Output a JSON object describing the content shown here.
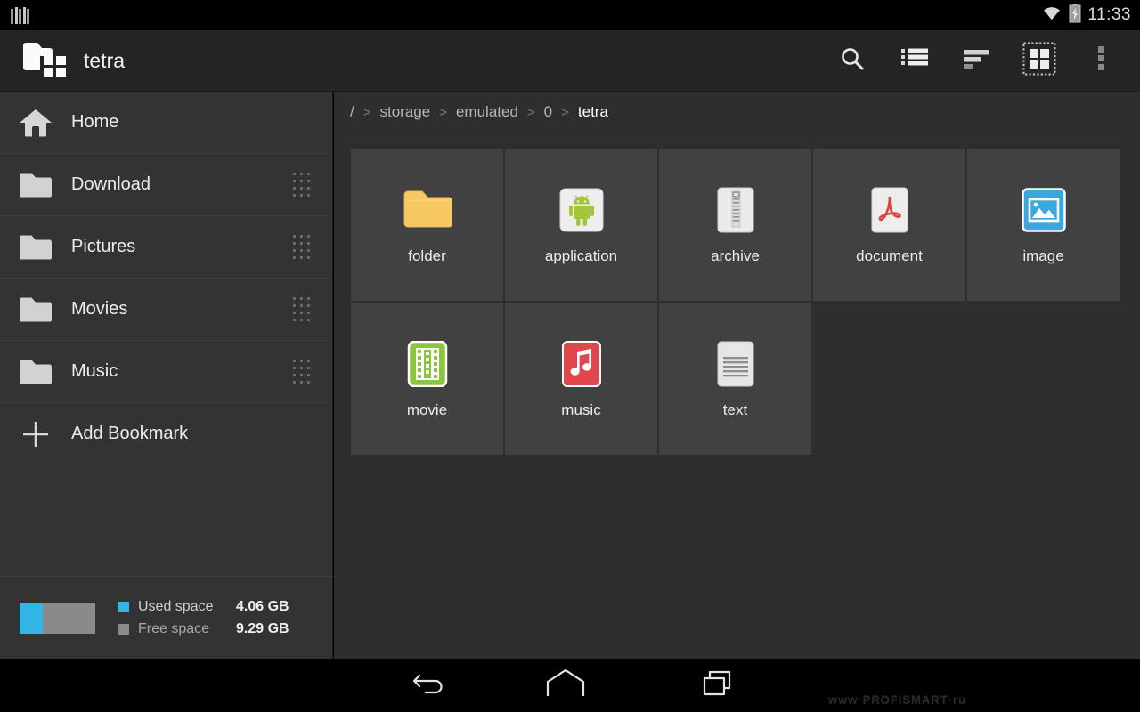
{
  "statusbar": {
    "notification_icon": "notification-bars-icon",
    "wifi_icon": "wifi-icon",
    "battery_icon": "battery-charging-icon",
    "time": "11:33"
  },
  "actionbar": {
    "logo_icon": "app-logo-folder-grid-icon",
    "title": "tetra",
    "actions": [
      {
        "name": "search",
        "icon": "search-icon",
        "label": "Search",
        "active": false
      },
      {
        "name": "list-view",
        "icon": "list-view-icon",
        "label": "List view",
        "active": false
      },
      {
        "name": "sort",
        "icon": "sort-icon",
        "label": "Sort",
        "active": false
      },
      {
        "name": "grid-view",
        "icon": "grid-view-icon",
        "label": "Grid view",
        "active": true
      },
      {
        "name": "overflow",
        "icon": "overflow-menu-icon",
        "label": "More options",
        "active": false
      }
    ]
  },
  "sidebar": {
    "items": [
      {
        "label": "Home",
        "icon": "home-icon",
        "draggable": false
      },
      {
        "label": "Download",
        "icon": "folder-icon",
        "draggable": true
      },
      {
        "label": "Pictures",
        "icon": "folder-icon",
        "draggable": true
      },
      {
        "label": "Movies",
        "icon": "folder-icon",
        "draggable": true
      },
      {
        "label": "Music",
        "icon": "folder-icon",
        "draggable": true
      },
      {
        "label": "Add Bookmark",
        "icon": "plus-icon",
        "draggable": false
      }
    ],
    "storage": {
      "used_label": "Used space",
      "used_value": "4.06 GB",
      "free_label": "Free space",
      "free_value": "9.29 GB",
      "used_color": "#33b5e5",
      "free_color": "#8a8a8a",
      "used_percent": 30
    }
  },
  "breadcrumb": {
    "separator": ">",
    "segments": [
      {
        "label": "/",
        "current": false
      },
      {
        "label": "storage",
        "current": false
      },
      {
        "label": "emulated",
        "current": false
      },
      {
        "label": "0",
        "current": false
      },
      {
        "label": "tetra",
        "current": true
      }
    ]
  },
  "files": [
    {
      "label": "folder",
      "icon": "folder-icon"
    },
    {
      "label": "application",
      "icon": "android-apk-icon"
    },
    {
      "label": "archive",
      "icon": "zip-archive-icon"
    },
    {
      "label": "document",
      "icon": "pdf-document-icon"
    },
    {
      "label": "image",
      "icon": "image-file-icon"
    },
    {
      "label": "movie",
      "icon": "video-file-icon"
    },
    {
      "label": "music",
      "icon": "audio-file-icon"
    },
    {
      "label": "text",
      "icon": "text-file-icon"
    }
  ],
  "navbar": {
    "back_icon": "back-icon",
    "home_icon": "home-nav-icon",
    "recents_icon": "recents-icon",
    "watermark": "www·PROFISMART·ru"
  },
  "colors": {
    "accent_blue": "#33b5e5",
    "actionbar_bg": "#242424",
    "sidebar_bg": "#333333",
    "content_bg": "#2e2e2e",
    "tile_bg": "#414141",
    "folder_yellow": "#f7c761",
    "android_green": "#a4c639",
    "pdf_red": "#d94040",
    "music_red": "#e0474c",
    "movie_green": "#8cc63e",
    "image_blue": "#3aa8dd"
  }
}
